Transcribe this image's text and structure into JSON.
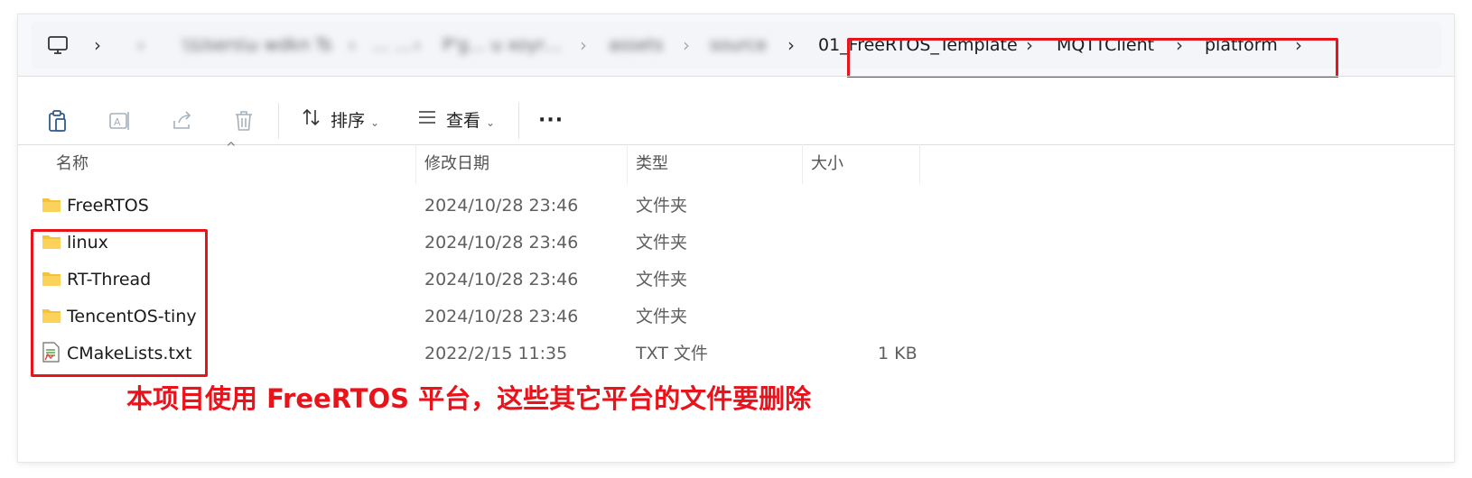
{
  "address": {
    "computer_icon": "computer-icon",
    "blurred_segments": [
      "\\\\Users\\u wdkn Ts",
      "… …",
      "P'g… u xoyr…"
    ],
    "segments_visible": [
      "assets",
      "source"
    ],
    "highlighted_segments": [
      "01_FreeRTOS_Template",
      "MQTTClient",
      "platform"
    ],
    "separator": ">"
  },
  "toolbar": {
    "icons": [
      "paste-icon",
      "rename-icon",
      "share-icon",
      "delete-icon"
    ],
    "sort_label": "排序",
    "view_label": "查看",
    "more_label": "···"
  },
  "columns": {
    "name": "名称",
    "modified": "修改日期",
    "type": "类型",
    "size": "大小"
  },
  "files": [
    {
      "name": "FreeRTOS",
      "modified": "2024/10/28 23:46",
      "type": "文件夹",
      "size": "",
      "icon": "folder-icon"
    },
    {
      "name": "linux",
      "modified": "2024/10/28 23:46",
      "type": "文件夹",
      "size": "",
      "icon": "folder-icon"
    },
    {
      "name": "RT-Thread",
      "modified": "2024/10/28 23:46",
      "type": "文件夹",
      "size": "",
      "icon": "folder-icon"
    },
    {
      "name": "TencentOS-tiny",
      "modified": "2024/10/28 23:46",
      "type": "文件夹",
      "size": "",
      "icon": "folder-icon"
    },
    {
      "name": "CMakeLists.txt",
      "modified": "2022/2/15 11:35",
      "type": "TXT 文件",
      "size": "1 KB",
      "icon": "text-file-icon"
    }
  ],
  "annotation": "本项目使用 FreeRTOS 平台，这些其它平台的文件要删除",
  "colors": {
    "highlight": "#e8131b",
    "folder": "#f7c23b"
  }
}
